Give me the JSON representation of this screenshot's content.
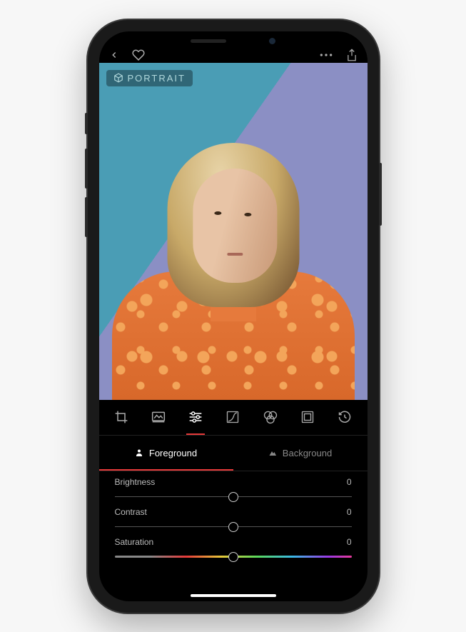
{
  "badge": {
    "label": "PORTRAIT"
  },
  "tools": [
    {
      "name": "crop"
    },
    {
      "name": "filters"
    },
    {
      "name": "adjust",
      "active": true
    },
    {
      "name": "curves"
    },
    {
      "name": "color-mix"
    },
    {
      "name": "frame"
    },
    {
      "name": "history"
    }
  ],
  "layer_tabs": {
    "foreground": {
      "label": "Foreground",
      "active": true
    },
    "background": {
      "label": "Background",
      "active": false
    }
  },
  "sliders": [
    {
      "name": "brightness",
      "label": "Brightness",
      "value": "0"
    },
    {
      "name": "contrast",
      "label": "Contrast",
      "value": "0"
    },
    {
      "name": "saturation",
      "label": "Saturation",
      "value": "0"
    }
  ],
  "accent": "#e63a3a"
}
